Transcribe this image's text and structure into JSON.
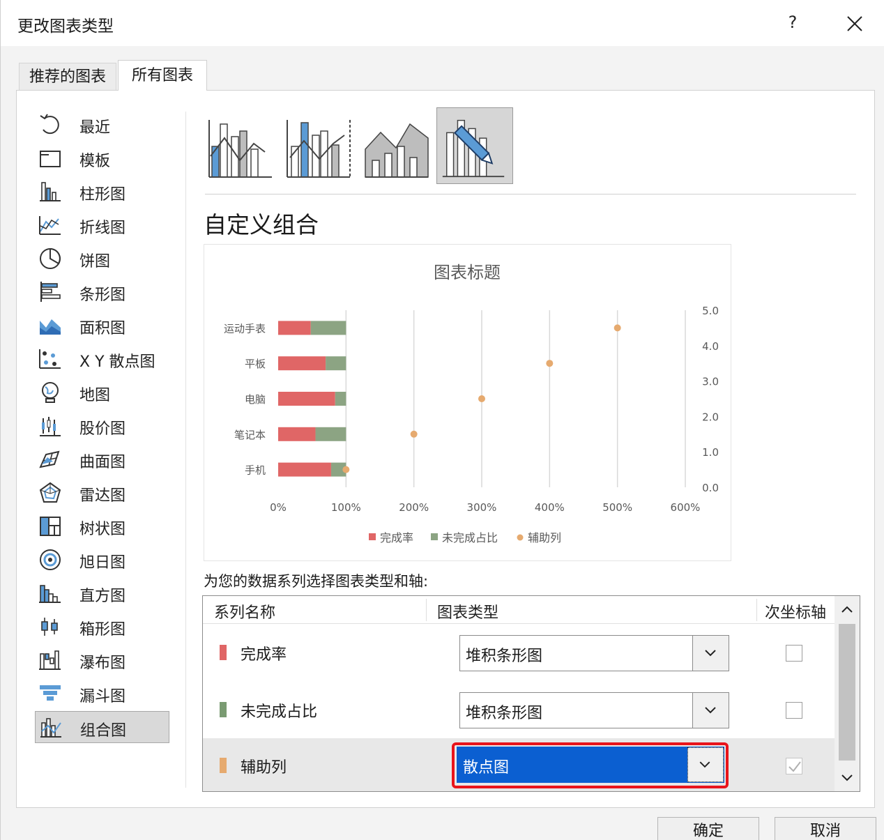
{
  "dialog": {
    "title": "更改图表类型",
    "help_label": "?"
  },
  "tabs": [
    {
      "label": "推荐的图表"
    },
    {
      "label": "所有图表"
    }
  ],
  "sidebar": {
    "items": [
      {
        "label": "最近",
        "icon": "recent-icon"
      },
      {
        "label": "模板",
        "icon": "template-icon"
      },
      {
        "label": "柱形图",
        "icon": "column-chart-icon"
      },
      {
        "label": "折线图",
        "icon": "line-chart-icon"
      },
      {
        "label": "饼图",
        "icon": "pie-chart-icon"
      },
      {
        "label": "条形图",
        "icon": "bar-chart-icon"
      },
      {
        "label": "面积图",
        "icon": "area-chart-icon"
      },
      {
        "label": "X Y 散点图",
        "icon": "scatter-chart-icon"
      },
      {
        "label": "地图",
        "icon": "map-chart-icon"
      },
      {
        "label": "股价图",
        "icon": "stock-chart-icon"
      },
      {
        "label": "曲面图",
        "icon": "surface-chart-icon"
      },
      {
        "label": "雷达图",
        "icon": "radar-chart-icon"
      },
      {
        "label": "树状图",
        "icon": "treemap-chart-icon"
      },
      {
        "label": "旭日图",
        "icon": "sunburst-chart-icon"
      },
      {
        "label": "直方图",
        "icon": "histogram-chart-icon"
      },
      {
        "label": "箱形图",
        "icon": "boxplot-chart-icon"
      },
      {
        "label": "瀑布图",
        "icon": "waterfall-chart-icon"
      },
      {
        "label": "漏斗图",
        "icon": "funnel-chart-icon"
      },
      {
        "label": "组合图",
        "icon": "combo-chart-icon"
      }
    ],
    "selected": "组合图"
  },
  "main": {
    "section_title": "自定义组合",
    "series_caption": "为您的数据系列选择图表类型和轴:",
    "table_headers": {
      "name": "系列名称",
      "type": "图表类型",
      "secondary_axis": "次坐标轴"
    },
    "series_rows": [
      {
        "name": "完成率",
        "color": "#e06666",
        "chart_type": "堆积条形图",
        "secondary": false,
        "secondary_enabled": true
      },
      {
        "name": "未完成占比",
        "color": "#7a9b72",
        "chart_type": "堆积条形图",
        "secondary": false,
        "secondary_enabled": true
      },
      {
        "name": "辅助列",
        "color": "#e6aa6f",
        "chart_type": "散点图",
        "secondary": true,
        "secondary_enabled": false
      }
    ]
  },
  "buttons": {
    "ok": "确定",
    "cancel": "取消"
  },
  "chart_data": {
    "type": "bar",
    "title": "图表标题",
    "categories": [
      "运动手表",
      "平板",
      "电脑",
      "笔记本",
      "手机"
    ],
    "series": [
      {
        "name": "完成率",
        "type": "stacked-bar",
        "color": "#e06666",
        "values": [
          0.48,
          0.7,
          0.84,
          0.55,
          0.78
        ]
      },
      {
        "name": "未完成占比",
        "type": "stacked-bar",
        "color": "#8ca483",
        "values": [
          0.52,
          0.3,
          0.16,
          0.45,
          0.22
        ]
      },
      {
        "name": "辅助列",
        "type": "scatter",
        "color": "#e6aa6f",
        "points": [
          {
            "x": 5.0,
            "y": 4.5
          },
          {
            "x": 4.0,
            "y": 3.5
          },
          {
            "x": 3.0,
            "y": 2.5
          },
          {
            "x": 2.0,
            "y": 1.5
          },
          {
            "x": 1.0,
            "y": 0.5
          }
        ]
      }
    ],
    "x_ticks": [
      "0%",
      "100%",
      "200%",
      "300%",
      "400%",
      "500%",
      "600%"
    ],
    "x_range": [
      0,
      6
    ],
    "secondary_y_ticks": [
      "0.0",
      "1.0",
      "2.0",
      "3.0",
      "4.0",
      "5.0"
    ],
    "secondary_y_range": [
      0,
      5
    ],
    "legend_position": "bottom",
    "grid": true
  }
}
